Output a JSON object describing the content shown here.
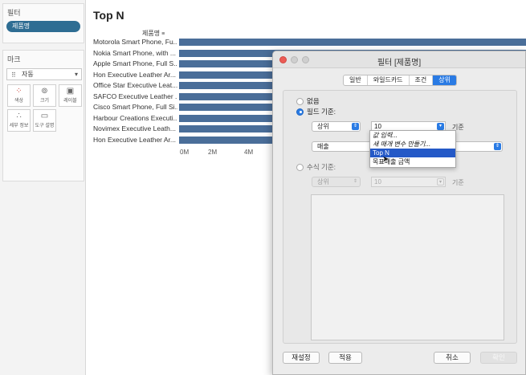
{
  "left_panel": {
    "filters_title": "필터",
    "filter_pill": "제품명",
    "marks_title": "마크",
    "mark_type": "자동",
    "mark_buttons": [
      {
        "label": "색상",
        "icon": "color-dots-icon"
      },
      {
        "label": "크기",
        "icon": "size-icon"
      },
      {
        "label": "레이블",
        "icon": "label-icon"
      },
      {
        "label": "세부 정보",
        "icon": "detail-icon"
      },
      {
        "label": "도구 설명",
        "icon": "tooltip-icon"
      }
    ]
  },
  "sheet": {
    "title": "Top N",
    "row_header": "제품명",
    "rows": [
      "Motorola Smart Phone, Fu...",
      "Nokia Smart Phone, with ...",
      "Apple Smart Phone, Full S...",
      "Hon Executive Leather Ar...",
      "Office Star Executive Leat...",
      "SAFCO Executive Leather ...",
      "Cisco Smart Phone, Full Si...",
      "Harbour Creations Executi...",
      "Novimex Executive Leath...",
      "Hon Executive Leather Ar..."
    ],
    "axis_ticks": [
      "0M",
      "2M",
      "4M"
    ]
  },
  "dialog": {
    "title": "필터 [제품명]",
    "tabs": [
      "일반",
      "와일드카드",
      "조건",
      "상위"
    ],
    "active_tab": "상위",
    "option_none": "없음",
    "option_by_field": "필드 기준:",
    "field_direction": "상위",
    "field_count": "10",
    "by_label": "기준",
    "field_measure": "매출",
    "option_by_formula": "수식 기준:",
    "formula_direction": "상위",
    "formula_count": "10",
    "formula_by_label": "기준",
    "dropdown_items": [
      "값 입력...",
      "새 매개 변수 만들기...",
      "Top N",
      "목표매출 금액"
    ],
    "dropdown_selected": "Top N",
    "buttons": {
      "reset": "재설정",
      "apply": "적용",
      "cancel": "취소",
      "ok": "확인"
    }
  }
}
